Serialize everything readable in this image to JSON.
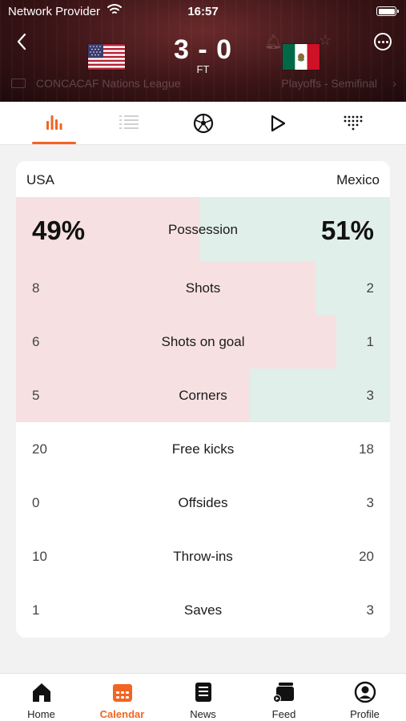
{
  "status_bar": {
    "carrier": "Network Provider",
    "time": "16:57"
  },
  "match": {
    "home_team": "USA",
    "away_team": "Mexico",
    "score": "3 - 0",
    "status": "FT",
    "competition": "CONCACAF Nations League",
    "stage": "Playoffs - Semifinal",
    "away_team_ghost": "Mexico"
  },
  "tabs": [
    {
      "name": "stats",
      "icon": "bar-chart-icon",
      "active": true
    },
    {
      "name": "lineups",
      "icon": "numbered-list-icon",
      "active": false
    },
    {
      "name": "events",
      "icon": "soccer-ball-icon",
      "active": false
    },
    {
      "name": "video",
      "icon": "play-icon",
      "active": false
    },
    {
      "name": "standings",
      "icon": "dot-grid-icon",
      "active": false
    }
  ],
  "colors": {
    "accent": "#f26422",
    "home_bar": "#f6e0e2",
    "away_bar": "#e0efe9"
  },
  "stats": [
    {
      "label": "Possession",
      "home": "49%",
      "away": "51%",
      "home_share": 0.49
    },
    {
      "label": "Shots",
      "home": "8",
      "away": "2",
      "home_share": 0.8
    },
    {
      "label": "Shots on goal",
      "home": "6",
      "away": "1",
      "home_share": 0.857
    },
    {
      "label": "Corners",
      "home": "5",
      "away": "3",
      "home_share": 0.625
    },
    {
      "label": "Free kicks",
      "home": "20",
      "away": "18"
    },
    {
      "label": "Offsides",
      "home": "0",
      "away": "3"
    },
    {
      "label": "Throw-ins",
      "home": "10",
      "away": "20"
    },
    {
      "label": "Saves",
      "home": "1",
      "away": "3"
    }
  ],
  "bottom_nav": [
    {
      "label": "Home",
      "icon": "home-icon",
      "active": false
    },
    {
      "label": "Calendar",
      "icon": "calendar-icon",
      "active": true
    },
    {
      "label": "News",
      "icon": "news-icon",
      "active": false
    },
    {
      "label": "Feed",
      "icon": "feed-icon",
      "active": false
    },
    {
      "label": "Profile",
      "icon": "profile-icon",
      "active": false
    }
  ]
}
